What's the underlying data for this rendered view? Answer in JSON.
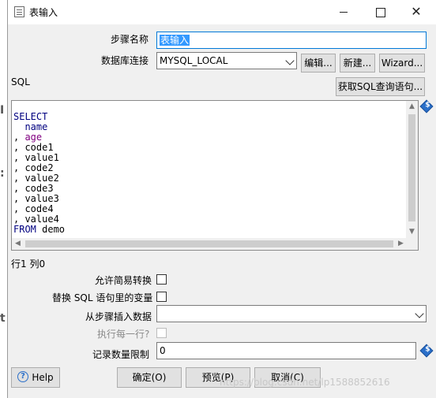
{
  "window": {
    "title": "表输入",
    "minimize_glyph": "",
    "maximize_glyph": "",
    "close_glyph": "✕"
  },
  "form": {
    "step_name_label": "步骤名称",
    "step_name_value": "表输入",
    "db_connection_label": "数据库连接",
    "db_connection_value": "MYSQL_LOCAL",
    "edit_button": "编辑...",
    "new_button": "新建...",
    "wizard_button": "Wizard...",
    "sql_label": "SQL",
    "get_sql_button": "获取SQL查询语句...",
    "position_status": "行1 列0",
    "allow_lazy_label": "允许简易转换",
    "replace_vars_label": "替换 SQL 语句里的变量",
    "insert_from_step_label": "从步骤插入数据",
    "insert_from_step_value": "",
    "execute_each_row_label": "执行每一行?",
    "record_limit_label": "记录数量限制",
    "record_limit_value": "0"
  },
  "sql_editor": {
    "lines": [
      {
        "text": "SELECT",
        "style": "kw"
      },
      {
        "text": "  name",
        "style": "kw"
      },
      {
        "text": ", age",
        "style": "mixed_pur"
      },
      {
        "text": ", code1",
        "style": "plain"
      },
      {
        "text": ", value1",
        "style": "plain"
      },
      {
        "text": ", code2",
        "style": "plain"
      },
      {
        "text": ", value2",
        "style": "plain"
      },
      {
        "text": ", code3",
        "style": "plain"
      },
      {
        "text": ", value3",
        "style": "plain"
      },
      {
        "text": ", code4",
        "style": "plain"
      },
      {
        "text": ", value4",
        "style": "plain"
      },
      {
        "text": "FROM demo",
        "style": "kw_from"
      }
    ]
  },
  "footer": {
    "help_button": "Help",
    "ok_button": "确定(O)",
    "preview_button": "预览(P)",
    "cancel_button": "取消(C)"
  },
  "watermark": "https://blog.csdn.net/lp1588852616"
}
